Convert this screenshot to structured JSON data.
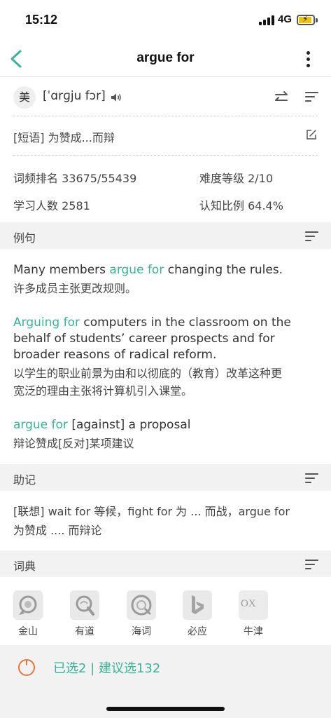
{
  "status": {
    "time": "15:12",
    "network": "4G",
    "battery_color": "#f2c200"
  },
  "nav": {
    "title": "argue for",
    "back_icon": "chevron-left-icon",
    "more_icon": "more-vertical-icon",
    "accent": "#3bb39a"
  },
  "phonetic": {
    "region": "美",
    "ipa": "[ˈɑrɡju fɔr]"
  },
  "meaning": "[短语] 为赞成...而辩",
  "stats": {
    "rank": "词频排名 33675/55439",
    "difficulty": "难度等级 2/10",
    "learners": "学习人数 2581",
    "recognition": "认知比例 64.4%"
  },
  "examples_section": {
    "title": "例句",
    "items": [
      {
        "lines": [
          {
            "parts": [
              {
                "t": "Many members ",
                "h": false
              },
              {
                "t": "argue for",
                "h": true
              },
              {
                "t": " changing the rules.",
                "h": false
              }
            ]
          }
        ],
        "translation": [
          "许多成员主张更改规则。"
        ]
      },
      {
        "lines": [
          {
            "parts": [
              {
                "t": "Arguing for",
                "h": true
              },
              {
                "t": " computers in the classroom on the",
                "h": false
              }
            ]
          },
          {
            "parts": [
              {
                "t": "behalf of students’ career prospects and for",
                "h": false
              }
            ]
          },
          {
            "parts": [
              {
                "t": "broader reasons of radical reform.",
                "h": false
              }
            ]
          }
        ],
        "translation": [
          "以学生的职业前景为由和以彻底的（教育）改革这种更",
          "宽泛的理由主张将计算机引入课堂。"
        ]
      },
      {
        "lines": [
          {
            "parts": [
              {
                "t": "argue for",
                "h": true
              },
              {
                "t": " [against] a proposal",
                "h": false
              }
            ]
          }
        ],
        "translation": [
          "辩论赞成[反对]某项建议"
        ]
      }
    ]
  },
  "mnemonic_section": {
    "title": "助记",
    "lines": [
      "[联想] wait for 等候，fight for 为 ... 而战，argue for",
      "为赞成 .... 而辩论"
    ]
  },
  "dictionary_section": {
    "title": "词典",
    "items": [
      {
        "label": "金山",
        "icon": "kingsoft-icon"
      },
      {
        "label": "有道",
        "icon": "youdao-icon"
      },
      {
        "label": "海词",
        "icon": "dict-cn-icon"
      },
      {
        "label": "必应",
        "icon": "bing-icon"
      },
      {
        "label": "牛津",
        "icon": "oxford-icon",
        "logo_text": "OX"
      }
    ]
  },
  "bottom": {
    "selected_text": "已选2 | 建议选132",
    "timer_color": "#e07a3a"
  }
}
